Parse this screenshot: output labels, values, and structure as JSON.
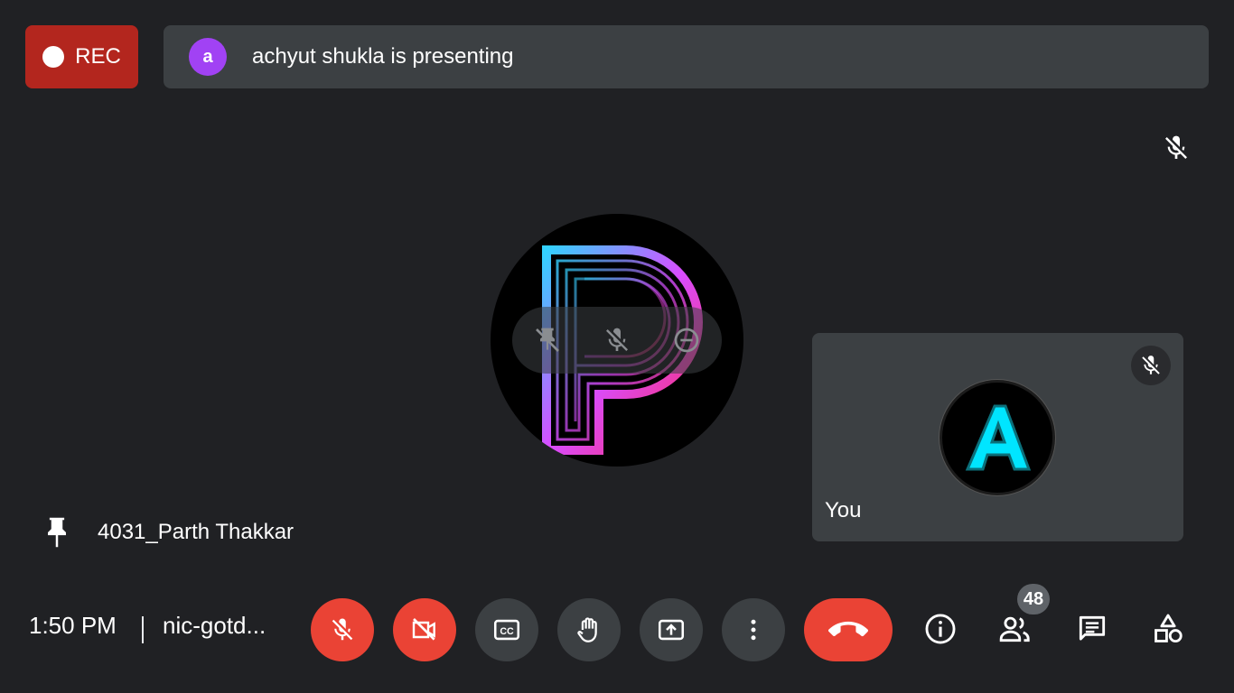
{
  "recording": {
    "label": "REC",
    "color": "#b3261e"
  },
  "presenting_bar": {
    "avatar_letter": "a",
    "avatar_color": "#a142f4",
    "text": "achyut shukla is presenting"
  },
  "main_tile": {
    "participant_name": "4031_Parth Thakkar",
    "avatar_icon": "neon-p-logo"
  },
  "self_tile": {
    "label": "You",
    "avatar_icon": "neon-a-logo"
  },
  "footer": {
    "time": "1:50 PM",
    "meeting_code": "nic-gotd...",
    "participants_count": "48"
  },
  "controls": [
    {
      "name": "microphone-off",
      "icon": "mic-off-icon"
    },
    {
      "name": "camera-off",
      "icon": "videocam-off-icon"
    },
    {
      "name": "captions",
      "icon": "cc-icon"
    },
    {
      "name": "raise-hand",
      "icon": "hand-icon"
    },
    {
      "name": "present",
      "icon": "present-icon"
    },
    {
      "name": "more-options",
      "icon": "more-vert-icon"
    },
    {
      "name": "leave-call",
      "icon": "call-end-icon"
    }
  ],
  "colors": {
    "background": "#202124",
    "surface": "#3c4043",
    "danger": "#ea4335"
  }
}
